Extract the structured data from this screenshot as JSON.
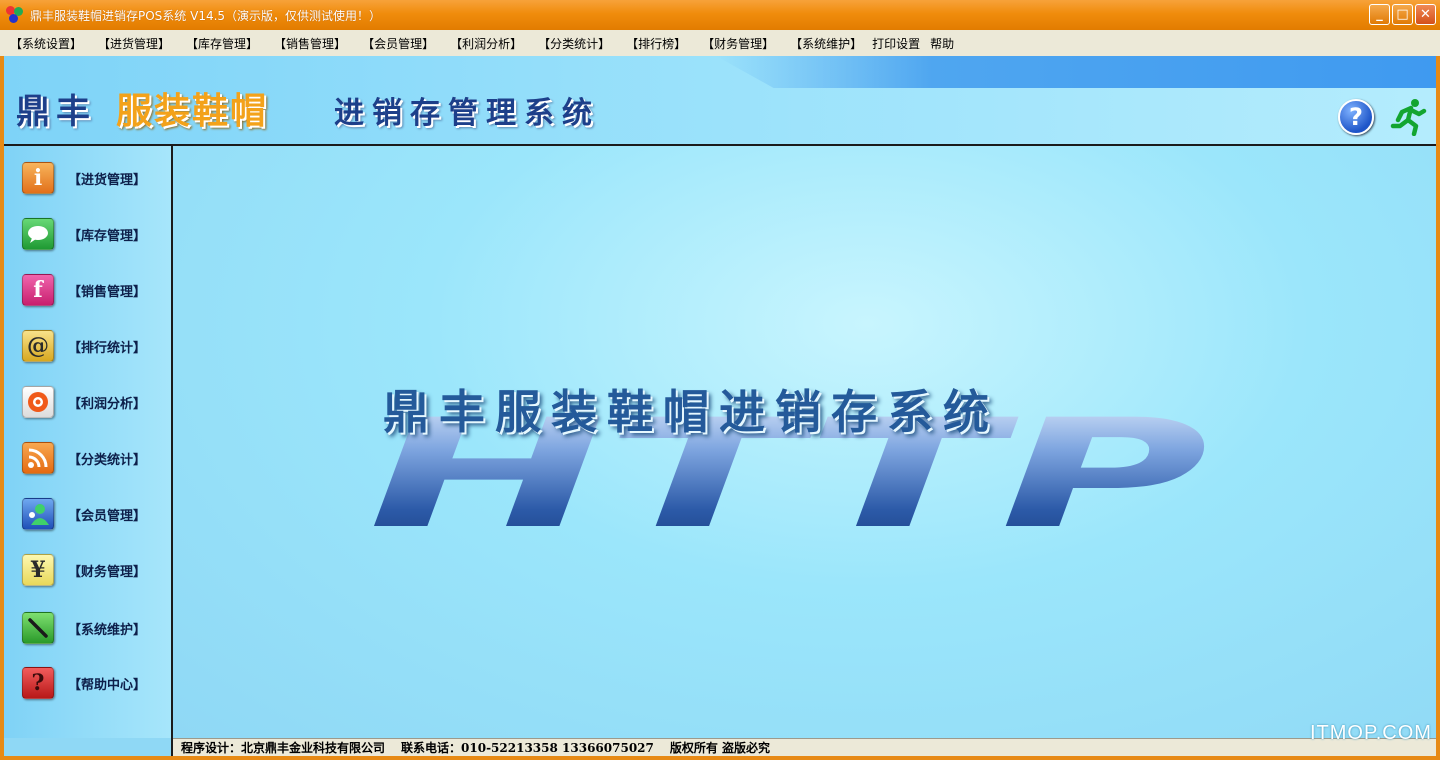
{
  "window": {
    "title": "鼎丰服装鞋帽进销存POS系统 V14.5（演示版，仅供测试使用！）",
    "minimize": "_",
    "maximize": "□",
    "close": "✕"
  },
  "menu": [
    "【系统设置】",
    "【进货管理】",
    "【库存管理】",
    "【销售管理】",
    "【会员管理】",
    "【利润分析】",
    "【分类统计】",
    "【排行榜】",
    "【财务管理】",
    "【系统维护】",
    "打印设置",
    "帮助"
  ],
  "banner": {
    "part1": "鼎丰",
    "part2": "服装鞋帽",
    "part3": "进销存管理系统",
    "help_glyph": "?"
  },
  "sidebar": [
    {
      "label": "【进货管理】",
      "icon": "info-icon",
      "glyph": "i",
      "color": "#f08a2c"
    },
    {
      "label": "【库存管理】",
      "icon": "chat-icon",
      "glyph": "",
      "color": "#35b84a"
    },
    {
      "label": "【销售管理】",
      "icon": "facebook-icon",
      "glyph": "f",
      "color": "#e0338a"
    },
    {
      "label": "【排行统计】",
      "icon": "at-sign-icon",
      "glyph": "@",
      "color": "#e8c43a"
    },
    {
      "label": "【利润分析】",
      "icon": "record-icon",
      "glyph": "◉",
      "color": "#f4f4f4"
    },
    {
      "label": "【分类统计】",
      "icon": "rss-icon",
      "glyph": "))",
      "color": "#f08a2c"
    },
    {
      "label": "【会员管理】",
      "icon": "user-icon",
      "glyph": "●",
      "color": "#2a5cc8"
    },
    {
      "label": "【财务管理】",
      "icon": "yen-icon",
      "glyph": "¥",
      "color": "#f6ef8a"
    },
    {
      "label": "【系统维护】",
      "icon": "pen-icon",
      "glyph": "/",
      "color": "#42b83a"
    },
    {
      "label": "【帮助中心】",
      "icon": "question-icon",
      "glyph": "?",
      "color": "#d62a2a"
    }
  ],
  "main": {
    "title": "鼎丰服装鞋帽进销存系统",
    "logo_text": "HTTP"
  },
  "status": {
    "designer": "程序设计：北京鼎丰金业科技有限公司",
    "phone": "联系电话：010-52213358 13366075027",
    "copyright": "版权所有 盗版必究"
  },
  "watermark": "ITMOP.COM"
}
